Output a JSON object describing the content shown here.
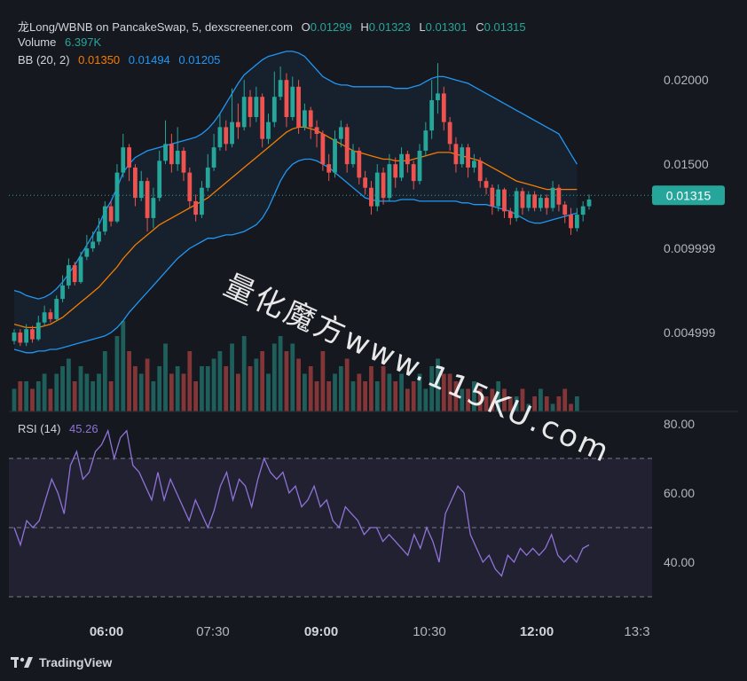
{
  "header": {
    "pair": "龙Long/WBNB on PancakeSwap, 5, dexscreener.com",
    "o_label": "O",
    "o": "0.01299",
    "h_label": "H",
    "h": "0.01323",
    "l_label": "L",
    "l": "0.01301",
    "c_label": "C",
    "c": "0.01315",
    "volume_label": "Volume",
    "volume": "6.397K",
    "bb_label": "BB (20, 2)",
    "bb_mid": "0.01350",
    "bb_upper": "0.01494",
    "bb_lower": "0.01205"
  },
  "rsi": {
    "label": "RSI (14)",
    "value": "45.26"
  },
  "watermark": "量化魔方www.115KU.com",
  "brand": "TradingView",
  "colors": {
    "up": "#26a69a",
    "down": "#ef5350",
    "bb_mid": "#f57c00",
    "bb_band": "#2196f3",
    "rsi": "#8f73d8",
    "bg": "#16181f"
  },
  "chart_data": [
    {
      "type": "candlestick",
      "price_axis_ticks": [
        "0.02000",
        "0.01500",
        "0.009999",
        "0.004999"
      ],
      "time_axis_ticks": [
        "06:00",
        "07:30",
        "09:00",
        "10:30",
        "12:00",
        "13:3"
      ],
      "last_price": "0.01315",
      "ylim": [
        0,
        0.023
      ],
      "candles": [
        [
          0.0045,
          0.005,
          0.0043,
          0.0052
        ],
        [
          0.005,
          0.0044,
          0.0042,
          0.0052
        ],
        [
          0.0044,
          0.0052,
          0.0042,
          0.0055
        ],
        [
          0.0052,
          0.0046,
          0.0044,
          0.0054
        ],
        [
          0.0046,
          0.0056,
          0.0045,
          0.006
        ],
        [
          0.0056,
          0.0062,
          0.0054,
          0.0066
        ],
        [
          0.0062,
          0.0058,
          0.0056,
          0.0064
        ],
        [
          0.0058,
          0.007,
          0.0057,
          0.0072
        ],
        [
          0.007,
          0.0078,
          0.0068,
          0.0084
        ],
        [
          0.0078,
          0.009,
          0.0076,
          0.0094
        ],
        [
          0.009,
          0.008,
          0.0078,
          0.0092
        ],
        [
          0.008,
          0.0095,
          0.0079,
          0.0098
        ],
        [
          0.0095,
          0.01,
          0.0093,
          0.0108
        ],
        [
          0.01,
          0.0104,
          0.0098,
          0.011
        ],
        [
          0.0104,
          0.011,
          0.0102,
          0.0118
        ],
        [
          0.011,
          0.0125,
          0.0108,
          0.0128
        ],
        [
          0.0125,
          0.0116,
          0.0113,
          0.0128
        ],
        [
          0.0116,
          0.0145,
          0.0115,
          0.015
        ],
        [
          0.0145,
          0.016,
          0.0142,
          0.0168
        ],
        [
          0.016,
          0.0148,
          0.014,
          0.0162
        ],
        [
          0.0148,
          0.013,
          0.0125,
          0.015
        ],
        [
          0.013,
          0.014,
          0.0128,
          0.0146
        ],
        [
          0.014,
          0.0118,
          0.011,
          0.0142
        ],
        [
          0.0118,
          0.013,
          0.0112,
          0.0136
        ],
        [
          0.013,
          0.0152,
          0.0128,
          0.0158
        ],
        [
          0.0152,
          0.0162,
          0.015,
          0.0176
        ],
        [
          0.0162,
          0.015,
          0.0145,
          0.0168
        ],
        [
          0.015,
          0.0158,
          0.0146,
          0.0172
        ],
        [
          0.0158,
          0.0145,
          0.014,
          0.016
        ],
        [
          0.0145,
          0.0128,
          0.0124,
          0.0148
        ],
        [
          0.0128,
          0.012,
          0.0116,
          0.0132
        ],
        [
          0.012,
          0.0136,
          0.0118,
          0.014
        ],
        [
          0.0136,
          0.0148,
          0.0134,
          0.0156
        ],
        [
          0.0148,
          0.016,
          0.0146,
          0.0168
        ],
        [
          0.016,
          0.0172,
          0.0158,
          0.018
        ],
        [
          0.0172,
          0.0162,
          0.0158,
          0.0176
        ],
        [
          0.0162,
          0.0175,
          0.016,
          0.0195
        ],
        [
          0.0175,
          0.0172,
          0.0165,
          0.0186
        ],
        [
          0.0172,
          0.019,
          0.017,
          0.02
        ],
        [
          0.019,
          0.0178,
          0.0172,
          0.0194
        ],
        [
          0.0178,
          0.019,
          0.0175,
          0.0196
        ],
        [
          0.019,
          0.0165,
          0.016,
          0.0192
        ],
        [
          0.0165,
          0.0175,
          0.0162,
          0.018
        ],
        [
          0.0175,
          0.019,
          0.0172,
          0.0205
        ],
        [
          0.019,
          0.02,
          0.0188,
          0.0208
        ],
        [
          0.02,
          0.0178,
          0.0172,
          0.0204
        ],
        [
          0.0178,
          0.0196,
          0.0176,
          0.0202
        ],
        [
          0.0196,
          0.0172,
          0.0168,
          0.02
        ],
        [
          0.0172,
          0.0182,
          0.017,
          0.0186
        ],
        [
          0.0182,
          0.0172,
          0.0165,
          0.0184
        ],
        [
          0.0172,
          0.0168,
          0.016,
          0.0176
        ],
        [
          0.0168,
          0.015,
          0.0146,
          0.017
        ],
        [
          0.015,
          0.0145,
          0.014,
          0.0156
        ],
        [
          0.0145,
          0.0165,
          0.0142,
          0.017
        ],
        [
          0.0165,
          0.0172,
          0.016,
          0.0176
        ],
        [
          0.0172,
          0.015,
          0.0145,
          0.0174
        ],
        [
          0.015,
          0.0158,
          0.0148,
          0.0162
        ],
        [
          0.0158,
          0.0142,
          0.0138,
          0.016
        ],
        [
          0.0142,
          0.0136,
          0.0132,
          0.0146
        ],
        [
          0.0136,
          0.0125,
          0.012,
          0.014
        ],
        [
          0.0125,
          0.0145,
          0.0122,
          0.015
        ],
        [
          0.0145,
          0.013,
          0.0126,
          0.0148
        ],
        [
          0.013,
          0.015,
          0.0128,
          0.0156
        ],
        [
          0.015,
          0.0142,
          0.0136,
          0.0154
        ],
        [
          0.0142,
          0.0156,
          0.014,
          0.016
        ],
        [
          0.0156,
          0.015,
          0.0145,
          0.0158
        ],
        [
          0.015,
          0.014,
          0.0135,
          0.0152
        ],
        [
          0.014,
          0.0158,
          0.0138,
          0.0162
        ],
        [
          0.0158,
          0.017,
          0.0155,
          0.0175
        ],
        [
          0.017,
          0.0188,
          0.0165,
          0.02
        ],
        [
          0.0188,
          0.0192,
          0.018,
          0.021
        ],
        [
          0.0192,
          0.0175,
          0.017,
          0.0196
        ],
        [
          0.0175,
          0.0162,
          0.0158,
          0.0178
        ],
        [
          0.0162,
          0.015,
          0.0145,
          0.0166
        ],
        [
          0.015,
          0.016,
          0.0148,
          0.0162
        ],
        [
          0.016,
          0.0148,
          0.0142,
          0.0162
        ],
        [
          0.0148,
          0.0152,
          0.0145,
          0.0156
        ],
        [
          0.0152,
          0.014,
          0.0136,
          0.0154
        ],
        [
          0.014,
          0.0136,
          0.0132,
          0.0142
        ],
        [
          0.0136,
          0.0125,
          0.012,
          0.0138
        ],
        [
          0.0125,
          0.0135,
          0.0122,
          0.0138
        ],
        [
          0.0135,
          0.0122,
          0.0118,
          0.0136
        ],
        [
          0.0122,
          0.0118,
          0.0114,
          0.0124
        ],
        [
          0.0118,
          0.0134,
          0.0116,
          0.0136
        ],
        [
          0.0134,
          0.0124,
          0.012,
          0.0136
        ],
        [
          0.0124,
          0.0132,
          0.0122,
          0.0134
        ],
        [
          0.0132,
          0.0124,
          0.0122,
          0.0134
        ],
        [
          0.0124,
          0.013,
          0.0122,
          0.0132
        ],
        [
          0.013,
          0.0124,
          0.012,
          0.0132
        ],
        [
          0.0124,
          0.0136,
          0.0122,
          0.014
        ],
        [
          0.0136,
          0.0126,
          0.0122,
          0.0138
        ],
        [
          0.0126,
          0.012,
          0.0115,
          0.0128
        ],
        [
          0.012,
          0.0112,
          0.0108,
          0.0124
        ],
        [
          0.0112,
          0.012,
          0.011,
          0.0124
        ],
        [
          0.012,
          0.0125,
          0.0116,
          0.0128
        ],
        [
          0.0125,
          0.0129,
          0.0123,
          0.0132
        ]
      ],
      "volume": [
        3,
        4,
        4,
        3,
        4,
        5,
        3,
        5,
        6,
        7,
        4,
        6,
        5,
        4,
        5,
        8,
        4,
        10,
        12,
        8,
        6,
        5,
        7,
        4,
        6,
        9,
        5,
        6,
        5,
        8,
        4,
        6,
        6,
        7,
        8,
        6,
        9,
        5,
        10,
        6,
        7,
        8,
        5,
        9,
        10,
        8,
        9,
        7,
        5,
        6,
        4,
        8,
        4,
        5,
        6,
        7,
        4,
        5,
        4,
        6,
        4,
        6,
        5,
        4,
        5,
        3,
        4,
        5,
        3,
        6,
        7,
        5,
        5,
        4,
        3,
        3,
        4,
        3,
        2,
        3,
        4,
        3,
        2,
        2,
        3,
        1,
        2,
        3,
        2,
        1,
        2,
        3,
        1,
        2
      ],
      "bb_upper": [
        0.0075,
        0.0074,
        0.0072,
        0.0071,
        0.007,
        0.0071,
        0.0073,
        0.0076,
        0.008,
        0.0085,
        0.009,
        0.0096,
        0.0102,
        0.0108,
        0.0114,
        0.0122,
        0.0128,
        0.0136,
        0.0145,
        0.015,
        0.0154,
        0.0156,
        0.0158,
        0.0159,
        0.016,
        0.0161,
        0.0162,
        0.0163,
        0.0164,
        0.0165,
        0.0166,
        0.0168,
        0.0171,
        0.0175,
        0.018,
        0.0186,
        0.0192,
        0.0198,
        0.0203,
        0.0206,
        0.0209,
        0.0212,
        0.0214,
        0.0215,
        0.0216,
        0.0217,
        0.0217,
        0.0216,
        0.0214,
        0.021,
        0.0206,
        0.0202,
        0.02,
        0.0198,
        0.0197,
        0.0197,
        0.0196,
        0.0196,
        0.0196,
        0.0196,
        0.0196,
        0.0196,
        0.0196,
        0.0195,
        0.0195,
        0.0195,
        0.0196,
        0.0197,
        0.0199,
        0.0201,
        0.0202,
        0.0202,
        0.0201,
        0.02,
        0.0199,
        0.0198,
        0.0196,
        0.0194,
        0.0192,
        0.019,
        0.0188,
        0.0186,
        0.0184,
        0.0182,
        0.018,
        0.0178,
        0.0176,
        0.0174,
        0.0172,
        0.017,
        0.0168,
        0.0162,
        0.0156,
        0.015
      ],
      "bb_mid": [
        0.0055,
        0.0054,
        0.0053,
        0.0053,
        0.0053,
        0.0054,
        0.0055,
        0.0057,
        0.0059,
        0.0062,
        0.0065,
        0.0068,
        0.0071,
        0.0074,
        0.0077,
        0.0081,
        0.0085,
        0.0089,
        0.0094,
        0.0098,
        0.0102,
        0.0105,
        0.0108,
        0.0111,
        0.0114,
        0.0116,
        0.0118,
        0.012,
        0.0122,
        0.0124,
        0.0126,
        0.0128,
        0.013,
        0.0133,
        0.0136,
        0.0139,
        0.0142,
        0.0145,
        0.0148,
        0.0151,
        0.0154,
        0.0157,
        0.016,
        0.0163,
        0.0166,
        0.0169,
        0.0171,
        0.0172,
        0.0172,
        0.0171,
        0.017,
        0.0168,
        0.0166,
        0.0164,
        0.0162,
        0.016,
        0.0158,
        0.0157,
        0.0156,
        0.0155,
        0.0154,
        0.0153,
        0.0153,
        0.0152,
        0.0152,
        0.0152,
        0.0153,
        0.0154,
        0.0155,
        0.0156,
        0.0157,
        0.0157,
        0.0157,
        0.0156,
        0.0155,
        0.0154,
        0.0153,
        0.0152,
        0.015,
        0.0148,
        0.0146,
        0.0144,
        0.0142,
        0.014,
        0.0139,
        0.0138,
        0.0137,
        0.0136,
        0.0135,
        0.0135,
        0.0135,
        0.0135,
        0.0135,
        0.0135
      ],
      "bb_lower": [
        0.004,
        0.0039,
        0.0038,
        0.0038,
        0.0039,
        0.0039,
        0.004,
        0.004,
        0.0041,
        0.0042,
        0.0043,
        0.0044,
        0.0045,
        0.0046,
        0.0047,
        0.0048,
        0.005,
        0.0053,
        0.0057,
        0.0062,
        0.0066,
        0.007,
        0.0074,
        0.0078,
        0.0082,
        0.0086,
        0.009,
        0.0094,
        0.0097,
        0.01,
        0.0102,
        0.0104,
        0.0106,
        0.0106,
        0.0107,
        0.0108,
        0.0108,
        0.0109,
        0.011,
        0.0112,
        0.0114,
        0.0118,
        0.0124,
        0.0132,
        0.014,
        0.0146,
        0.015,
        0.0152,
        0.0153,
        0.0153,
        0.0152,
        0.015,
        0.0148,
        0.0145,
        0.0142,
        0.0139,
        0.0136,
        0.0133,
        0.013,
        0.0129,
        0.0128,
        0.0128,
        0.0128,
        0.0128,
        0.0129,
        0.0129,
        0.0129,
        0.0128,
        0.0128,
        0.0128,
        0.0128,
        0.0128,
        0.0128,
        0.0128,
        0.0127,
        0.0127,
        0.0126,
        0.0126,
        0.0126,
        0.0125,
        0.0124,
        0.0123,
        0.0122,
        0.012,
        0.0118,
        0.0116,
        0.0115,
        0.0115,
        0.0116,
        0.0117,
        0.0118,
        0.0119,
        0.012,
        0.0121
      ]
    },
    {
      "type": "line",
      "name": "RSI (14)",
      "ylim": [
        25,
        82
      ],
      "y_ticks": [
        "80.00",
        "60.00",
        "40.00"
      ],
      "guide_levels": [
        70,
        50,
        30
      ],
      "values": [
        50,
        45,
        52,
        50,
        52,
        58,
        64,
        60,
        54,
        68,
        72,
        64,
        66,
        72,
        74,
        78,
        70,
        76,
        78,
        68,
        66,
        62,
        58,
        66,
        58,
        64,
        60,
        56,
        52,
        58,
        54,
        50,
        55,
        62,
        66,
        58,
        64,
        62,
        56,
        64,
        70,
        66,
        64,
        66,
        60,
        62,
        56,
        58,
        62,
        56,
        58,
        52,
        50,
        56,
        54,
        52,
        48,
        50,
        50,
        46,
        48,
        46,
        44,
        42,
        48,
        44,
        50,
        46,
        40,
        54,
        58,
        62,
        60,
        48,
        44,
        40,
        42,
        38,
        36,
        42,
        40,
        44,
        42,
        44,
        42,
        44,
        48,
        42,
        40,
        42,
        40,
        44,
        45
      ]
    }
  ]
}
